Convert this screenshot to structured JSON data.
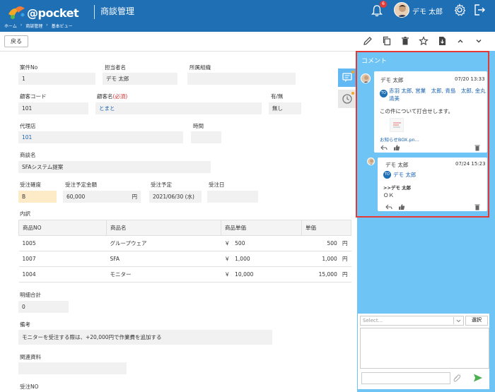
{
  "header": {
    "logo": "@pocket",
    "app_title": "商談管理",
    "breadcrumbs": [
      "ホーム",
      "商談管理",
      "基本ビュー"
    ],
    "notification_count": "6",
    "user_name": "デモ 太郎"
  },
  "toolbar": {
    "back_label": "戻る",
    "icons": [
      "pencil-icon",
      "copy-icon",
      "trash-icon",
      "star-icon",
      "export-icon",
      "chevron-up-icon",
      "chevron-down-icon"
    ]
  },
  "form": {
    "case_no": {
      "label": "案件No",
      "value": "1"
    },
    "owner": {
      "label": "担当者名",
      "value": "デモ 太郎"
    },
    "org": {
      "label": "所属組織",
      "value": ""
    },
    "customer_code": {
      "label": "顧客コード",
      "value": "101"
    },
    "customer_name": {
      "label": "顧客名",
      "required": "(必須)",
      "value": "とまと"
    },
    "flag": {
      "label": "有/無",
      "value": "無し"
    },
    "agency": {
      "label": "代理店",
      "value": "101"
    },
    "period": {
      "label": "時間",
      "value": ""
    },
    "deal_name": {
      "label": "商談名",
      "value": "SFAシステム提案"
    },
    "accuracy": {
      "label": "受注確度",
      "value": "B"
    },
    "amount": {
      "label": "受注予定金額",
      "value": "60,000",
      "unit": "円"
    },
    "planned_date": {
      "label": "受注予定",
      "value": "2021/06/30 (水)"
    },
    "order_date": {
      "label": "受注日",
      "value": ""
    },
    "details_label": "内訳",
    "details_headers": [
      "商品NO",
      "商品名",
      "商品単価",
      "単価"
    ],
    "details_rows": [
      {
        "no": "1005",
        "name": "グループウェア",
        "cur": "￥",
        "price": "500",
        "unit_price": "500",
        "yen": "円"
      },
      {
        "no": "1007",
        "name": "SFA",
        "cur": "￥",
        "price": "1,000",
        "unit_price": "1,000",
        "yen": "円"
      },
      {
        "no": "1004",
        "name": "モニター",
        "cur": "￥",
        "price": "10,000",
        "unit_price": "15,000",
        "yen": "円"
      }
    ],
    "total": {
      "label": "明細合計",
      "value": "0"
    },
    "notes": {
      "label": "備考",
      "value": "モニターを受注する際は、+20,000円で作業費を追加する"
    },
    "related": {
      "label": "関連資料",
      "value": ""
    },
    "order_no": {
      "label": "受注NO"
    }
  },
  "comments": {
    "title": "コメント",
    "items": [
      {
        "author": "デモ 太郎",
        "time": "07/20 13:33",
        "to_badge": "TO",
        "to": "赤羽 太郎, 営業　太郎, 青島　太郎, 金丸清美",
        "text": "この件について打合せします。",
        "file": "お知らせBOX.pn..."
      },
      {
        "author": "デモ 太郎",
        "time": "07/24 15:23",
        "to_badge": "TO",
        "to": "デモ 太郎",
        "quote": ">>デモ 太郎",
        "text": "ＯＫ"
      }
    ],
    "composer": {
      "select_placeholder": "Select...",
      "select_button": "選択"
    }
  },
  "colors": {
    "header": "#1f6fb5",
    "side_panel": "#6ec5f5",
    "highlight": "#e53935"
  }
}
